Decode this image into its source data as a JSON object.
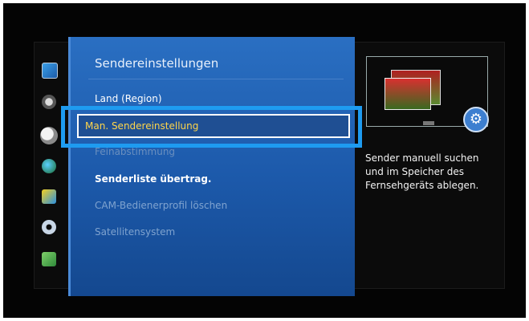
{
  "menu": {
    "title": "Sendereinstellungen",
    "items": [
      {
        "label": "Land (Region)"
      },
      {
        "label": "Man. Sendereinstellung"
      },
      {
        "label": "Feinabstimmung"
      },
      {
        "label": "Senderliste übertrag."
      },
      {
        "label": "CAM-Bedienerprofil löschen"
      },
      {
        "label": "Satellitensystem"
      }
    ],
    "selected_index": 1
  },
  "sidebar": {
    "icons": [
      "picture-icon",
      "sound-icon",
      "broadcast-icon",
      "network-icon",
      "smart-features-icon",
      "system-icon",
      "support-icon"
    ]
  },
  "help": {
    "lines": [
      "Sender manuell suchen",
      "und im Speicher des",
      "Fernsehgeräts ablegen."
    ]
  },
  "colors": {
    "panel": "#1c59aa",
    "highlight": "#1e9bf0",
    "selected_text": "#ffd54a"
  }
}
